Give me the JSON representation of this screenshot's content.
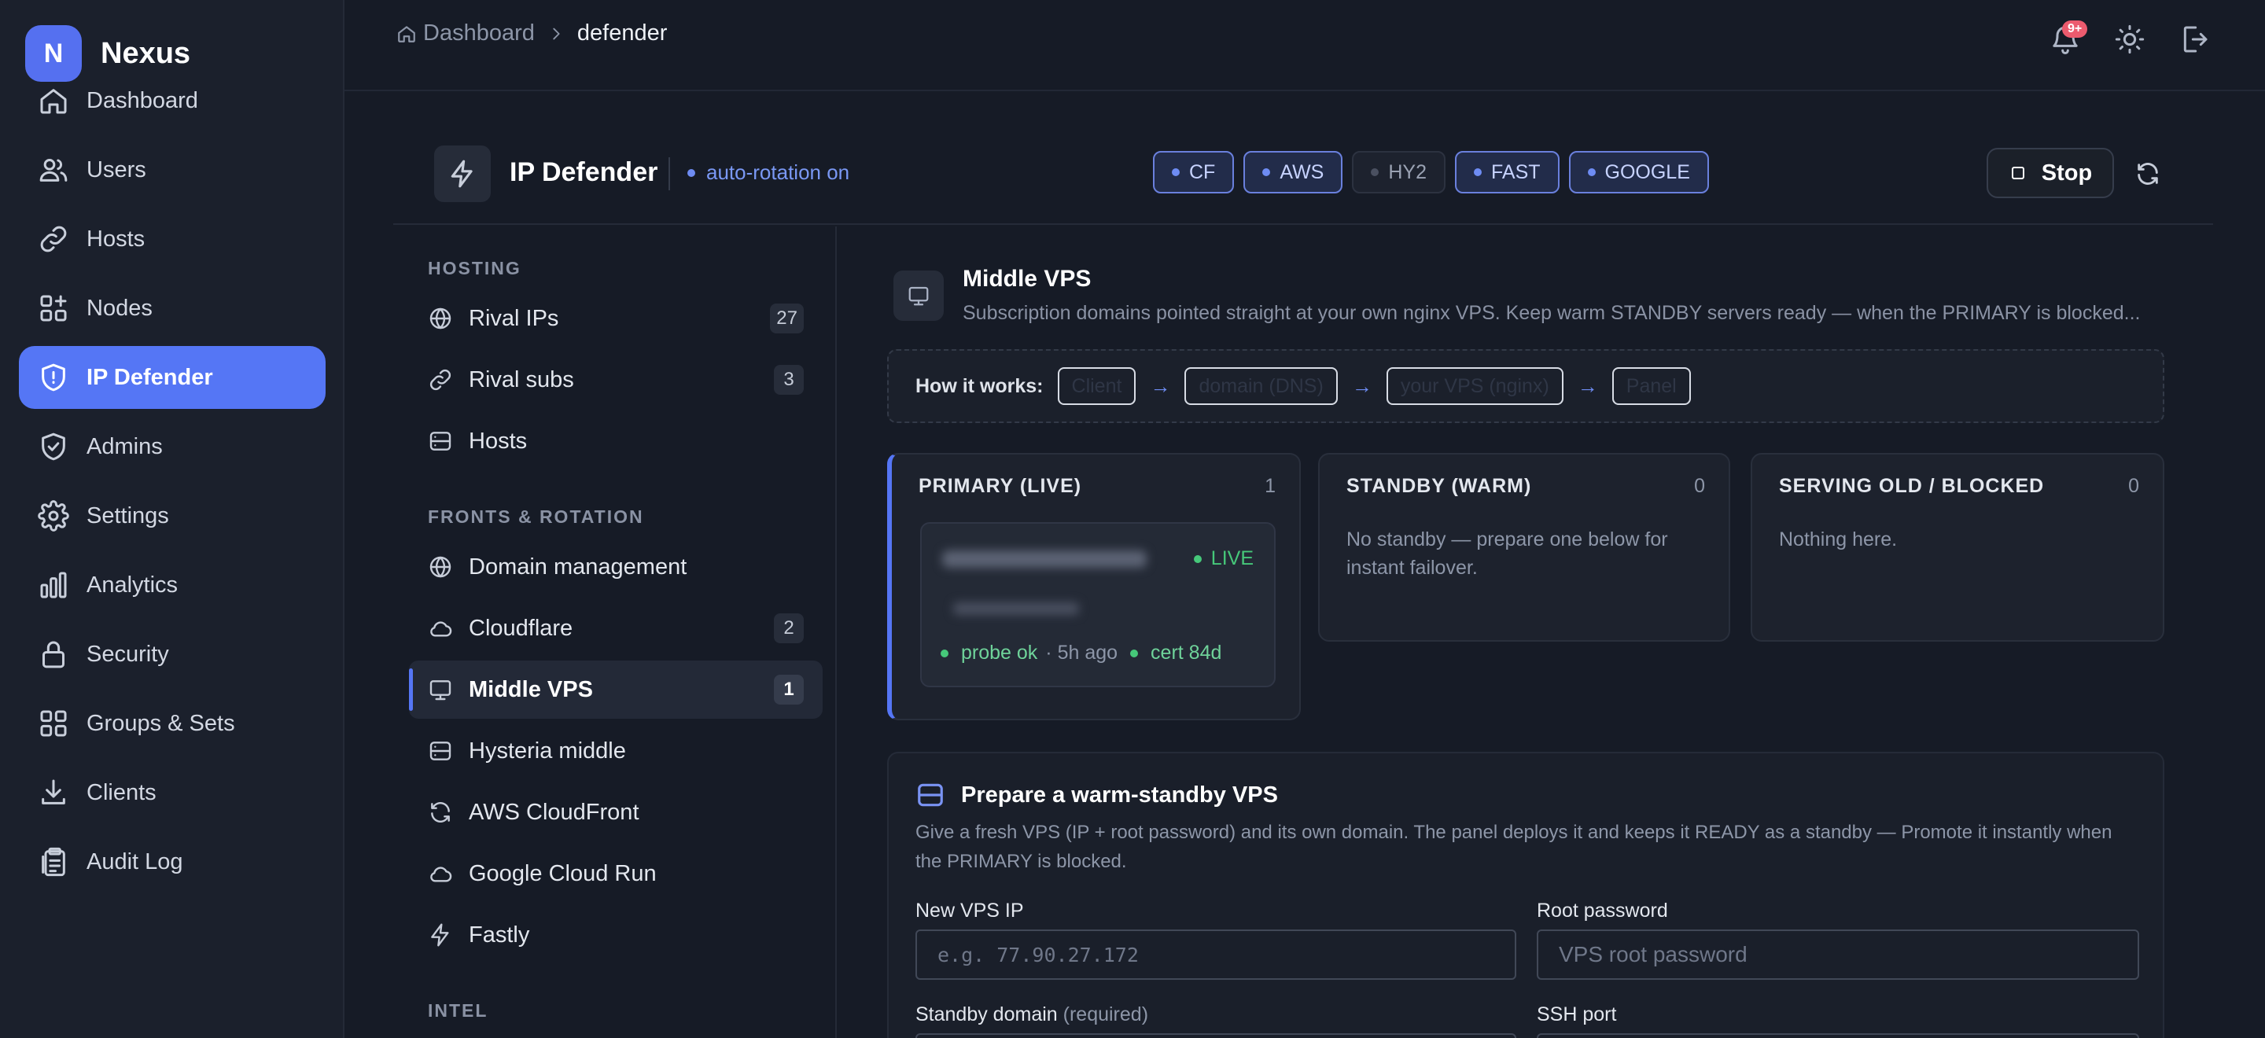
{
  "app": {
    "logo_letter": "N",
    "name": "Nexus"
  },
  "sidebar": {
    "items": [
      {
        "label": "Dashboard",
        "icon": "home-icon"
      },
      {
        "label": "Users",
        "icon": "users-icon"
      },
      {
        "label": "Hosts",
        "icon": "link-icon"
      },
      {
        "label": "Nodes",
        "icon": "nodes-icon"
      },
      {
        "label": "IP Defender",
        "icon": "shield-icon",
        "active": true
      },
      {
        "label": "Admins",
        "icon": "shield-check-icon"
      },
      {
        "label": "Settings",
        "icon": "gear-icon"
      },
      {
        "label": "Analytics",
        "icon": "bar-chart-icon"
      },
      {
        "label": "Security",
        "icon": "lock-icon"
      },
      {
        "label": "Groups & Sets",
        "icon": "grid-icon"
      },
      {
        "label": "Clients",
        "icon": "download-icon"
      },
      {
        "label": "Audit Log",
        "icon": "clipboard-icon"
      }
    ]
  },
  "topbar": {
    "breadcrumb": {
      "root": "Dashboard",
      "current": "defender"
    },
    "notification_badge": "9+"
  },
  "header": {
    "title": "IP Defender",
    "status": "auto-rotation on",
    "chips": [
      {
        "label": "CF",
        "active": true
      },
      {
        "label": "AWS",
        "active": true
      },
      {
        "label": "HY2",
        "active": false
      },
      {
        "label": "FAST",
        "active": true
      },
      {
        "label": "GOOGLE",
        "active": true
      }
    ],
    "stop_label": "Stop"
  },
  "subnav": {
    "hosting_heading": "HOSTING",
    "hosting": [
      {
        "label": "Rival IPs",
        "count": "27",
        "icon": "globe-icon"
      },
      {
        "label": "Rival subs",
        "count": "3",
        "icon": "link-icon"
      },
      {
        "label": "Hosts",
        "count": "",
        "icon": "server-icon"
      }
    ],
    "fronts_heading": "FRONTS & ROTATION",
    "fronts": [
      {
        "label": "Domain management",
        "count": "",
        "icon": "globe-icon"
      },
      {
        "label": "Cloudflare",
        "count": "2",
        "icon": "cloud-icon"
      },
      {
        "label": "Middle VPS",
        "count": "1",
        "icon": "monitor-icon",
        "active": true
      },
      {
        "label": "Hysteria middle",
        "count": "",
        "icon": "server-icon"
      },
      {
        "label": "AWS CloudFront",
        "count": "",
        "icon": "refresh-icon"
      },
      {
        "label": "Google Cloud Run",
        "count": "",
        "icon": "cloud-icon"
      },
      {
        "label": "Fastly",
        "count": "",
        "icon": "bolt-icon"
      }
    ],
    "intel_heading": "INTEL"
  },
  "main": {
    "title": "Middle VPS",
    "description": "Subscription domains pointed straight at your own nginx VPS. Keep warm STANDBY servers ready — when the PRIMARY is blocked...",
    "how_label": "How it works:",
    "flow": [
      "Client",
      "domain (DNS)",
      "your VPS (nginx)",
      "Panel"
    ],
    "columns": {
      "primary": {
        "title": "PRIMARY (LIVE)",
        "count": "1"
      },
      "standby": {
        "title": "STANDBY (WARM)",
        "count": "0",
        "empty": "No standby — prepare one below for instant failover."
      },
      "blocked": {
        "title": "SERVING OLD / BLOCKED",
        "count": "0",
        "empty": "Nothing here."
      }
    },
    "server": {
      "status": "LIVE",
      "probe": "probe ok",
      "ago": "· 5h ago",
      "cert": "cert 84d"
    }
  },
  "prepare": {
    "title": "Prepare a warm-standby VPS",
    "description": "Give a fresh VPS (IP + root password) and its own domain. The panel deploys it and keeps it READY as a standby — Promote it instantly when the PRIMARY is blocked.",
    "ip_label": "New VPS IP",
    "ip_placeholder": "e.g. 77.90.27.172",
    "password_label": "Root password",
    "password_placeholder": "VPS root password",
    "domain_label": "Standby domain",
    "domain_label_suffix": "(required)",
    "ssh_label": "SSH port"
  },
  "colors": {
    "accent": "#5576f5",
    "live": "#46c87a",
    "background": "#161b26",
    "sidebar": "#1b202c"
  }
}
